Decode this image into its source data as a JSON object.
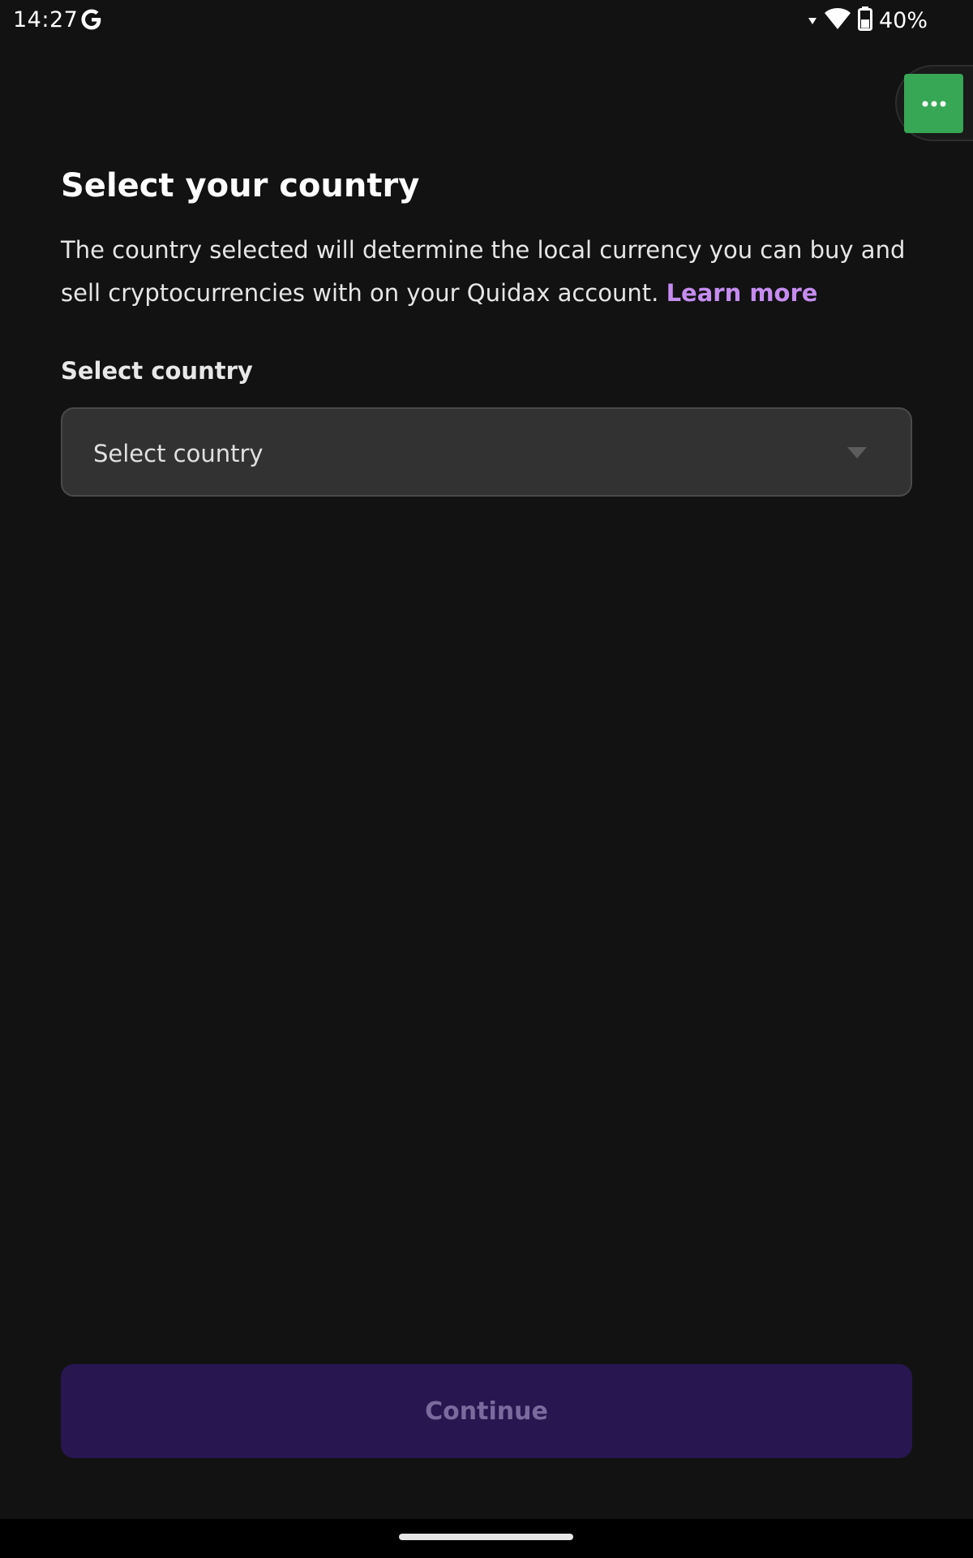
{
  "status_bar": {
    "time": "14:27",
    "battery": "40%",
    "icons": [
      "google-g-icon",
      "signal-arrow-icon",
      "wifi-icon",
      "battery-icon"
    ]
  },
  "floating_menu": {
    "icon": "more-horizontal-icon",
    "color": "#37a655"
  },
  "page": {
    "title": "Select your country",
    "description": "The country selected will determine the local currency you can buy and sell cryptocurrencies with on your Quidax account.",
    "learn_more": "Learn more",
    "link_color": "#c58cf0"
  },
  "country_field": {
    "label": "Select country",
    "placeholder": "Select country",
    "icon": "chevron-down-icon"
  },
  "actions": {
    "continue_label": "Continue",
    "button_color": "#27164f"
  }
}
